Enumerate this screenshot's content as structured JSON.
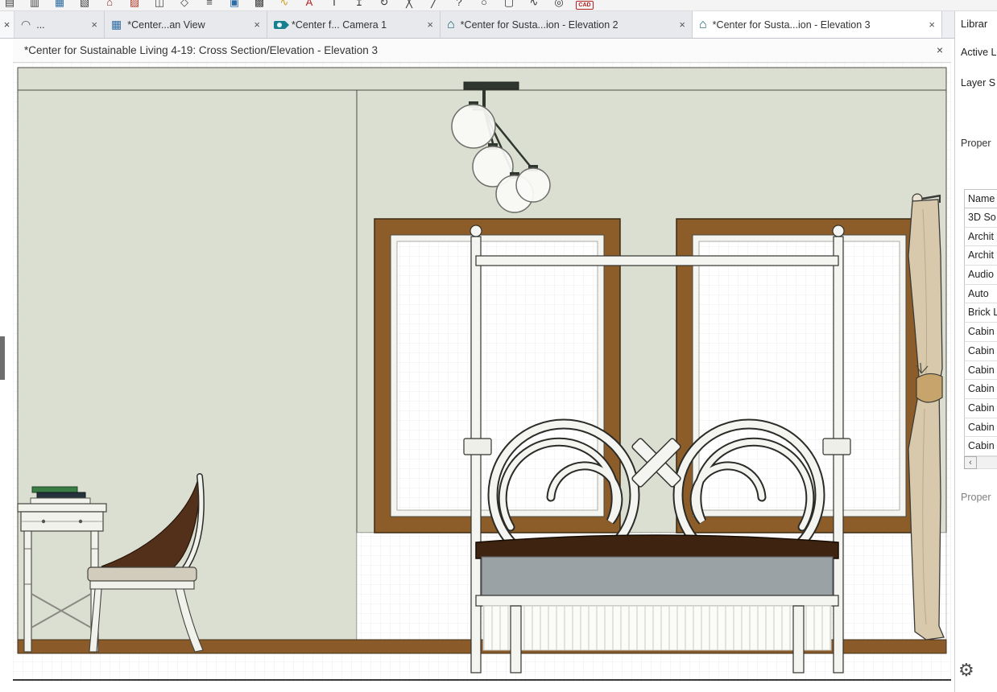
{
  "ui": {
    "close_glyph": "×",
    "gear_glyph": "⚙"
  },
  "toolbar": {
    "icons": [
      {
        "name": "open-plan-icon",
        "glyph": "▤",
        "color": "#3f3f3f"
      },
      {
        "name": "save-icon",
        "glyph": "▥",
        "color": "#3f3f3f"
      },
      {
        "name": "plan-view-icon",
        "glyph": "▦",
        "color": "#2e6da4"
      },
      {
        "name": "elevation-view-icon",
        "glyph": "▧",
        "color": "#3f3f3f"
      },
      {
        "name": "house-view-icon",
        "glyph": "⌂",
        "color": "#8a2a2a"
      },
      {
        "name": "materials-list-icon",
        "glyph": "▨",
        "color": "#b23a2a"
      },
      {
        "name": "layout-icon",
        "glyph": "◫",
        "color": "#3f3f3f"
      },
      {
        "name": "reference-icon",
        "glyph": "◇",
        "color": "#3f3f3f"
      },
      {
        "name": "layers-icon",
        "glyph": "≡",
        "color": "#3f3f3f"
      },
      {
        "name": "library-icon",
        "glyph": "▣",
        "color": "#2e6da4"
      },
      {
        "name": "display-options-icon",
        "glyph": "▩",
        "color": "#3f3f3f"
      },
      {
        "name": "dimension-tool-icon",
        "glyph": "∿",
        "color": "#c9a227"
      },
      {
        "name": "text-tool-icon",
        "glyph": "A",
        "color": "#b22222"
      },
      {
        "name": "text-T-icon",
        "glyph": "T",
        "color": "#333333"
      },
      {
        "name": "select-arrow-icon",
        "glyph": "↥",
        "color": "#333333"
      },
      {
        "name": "rotate-icon",
        "glyph": "↻",
        "color": "#333333"
      },
      {
        "name": "delete-icon",
        "glyph": "╳",
        "color": "#333333"
      },
      {
        "name": "line-tool-icon",
        "glyph": "╱",
        "color": "#333333"
      },
      {
        "name": "help-icon",
        "glyph": "?",
        "color": "#333333"
      },
      {
        "name": "circle-tool-icon",
        "glyph": "○",
        "color": "#333333"
      },
      {
        "name": "box-tool-icon",
        "glyph": "▢",
        "color": "#333333"
      },
      {
        "name": "spline-tool-icon",
        "glyph": "∿",
        "color": "#333333"
      },
      {
        "name": "zoom-tool-icon",
        "glyph": "◎",
        "color": "#333333"
      },
      {
        "name": "cad-tools-icon",
        "glyph": "CAD",
        "color": "#b22222",
        "type": "cad"
      }
    ]
  },
  "tabs": [
    {
      "label": "...",
      "icon": "arc",
      "icon_glyph": "◠"
    },
    {
      "label": "*Center...an View",
      "icon": "plan",
      "icon_glyph": "▦"
    },
    {
      "label": "*Center f... Camera 1",
      "icon": "camera",
      "icon_glyph": ""
    },
    {
      "label": "*Center for Susta...ion - Elevation 2",
      "icon": "house",
      "icon_glyph": "⌂"
    },
    {
      "label": "*Center for Susta...ion - Elevation 3",
      "icon": "house",
      "icon_glyph": "⌂",
      "active": true
    }
  ],
  "view_title": "*Center for Sustainable Living 4-19: Cross Section/Elevation - Elevation 3",
  "panel": {
    "library_label": "Librar",
    "active_layer_label": "Active L",
    "layer_set_label": "Layer S",
    "properties_label": "Proper",
    "properties2_label": "Proper",
    "table_header": "Name",
    "layer_rows": [
      "3D So",
      "Archit",
      "Archit",
      "Audio",
      "Auto",
      "Brick L",
      "Cabin",
      "Cabin",
      "Cabin",
      "Cabin",
      "Cabin",
      "Cabin",
      "Cabin"
    ],
    "scroll_left_arrow": "‹"
  },
  "drawing": {
    "scene": "bedroom elevation: canopy bed with scroll headboard, two brown-framed windows, pendant light with glass globes, writing desk with books, side chair, tied-back curtain",
    "colors": {
      "wall_sage": "#dbdfd2",
      "window_frame_brown": "#8d5d29",
      "floor_brown": "#8a5a28",
      "mattress_brown": "#3e2410",
      "bed_base_gray": "#9aa2a6",
      "curtain_tan": "#d9c9ac",
      "chair_back_brown": "#53301a",
      "metal_white": "#f4f4f0"
    }
  }
}
